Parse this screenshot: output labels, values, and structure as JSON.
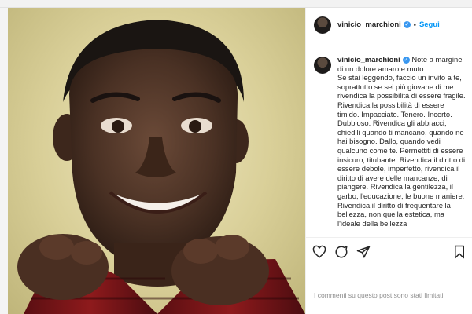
{
  "post": {
    "author": "vinicio_marchioni",
    "header_separator": "•",
    "follow_label": "Segui",
    "verified_icon": "check-icon",
    "caption_text": "Note a margine di un dolore amaro e muto.\nSe stai leggendo, faccio un invito a te, soprattutto se sei più giovane di me: rivendica la possibilità di essere fragile. Rivendica la possibilità di essere timido. Impacciato. Tenero. Incerto. Dubbioso. Rivendica gli abbracci, chiedili quando ti mancano, quando ne hai bisogno. Dallo, quando vedi qualcuno come te. Permettiti di essere insicuro, titubante. Rivendica il diritto di essere debole, imperfetto, rivendica il diritto di avere delle mancanze, di piangere. Rivendica la gentilezza, il garbo, l'educazione, le buone maniere. Rivendica il diritto di frequentare la bellezza, non quella estetica, ma l'ideale della bellezza",
    "comments_notice": "I commenti su questo post sono stati limitati."
  },
  "actions": {
    "like_icon": "heart-icon",
    "comment_icon": "comment-icon",
    "share_icon": "share-icon",
    "save_icon": "bookmark-icon"
  },
  "colors": {
    "accent": "#0095f6",
    "verified": "#3897f0",
    "text": "#262626",
    "muted": "#8e8e8e"
  }
}
